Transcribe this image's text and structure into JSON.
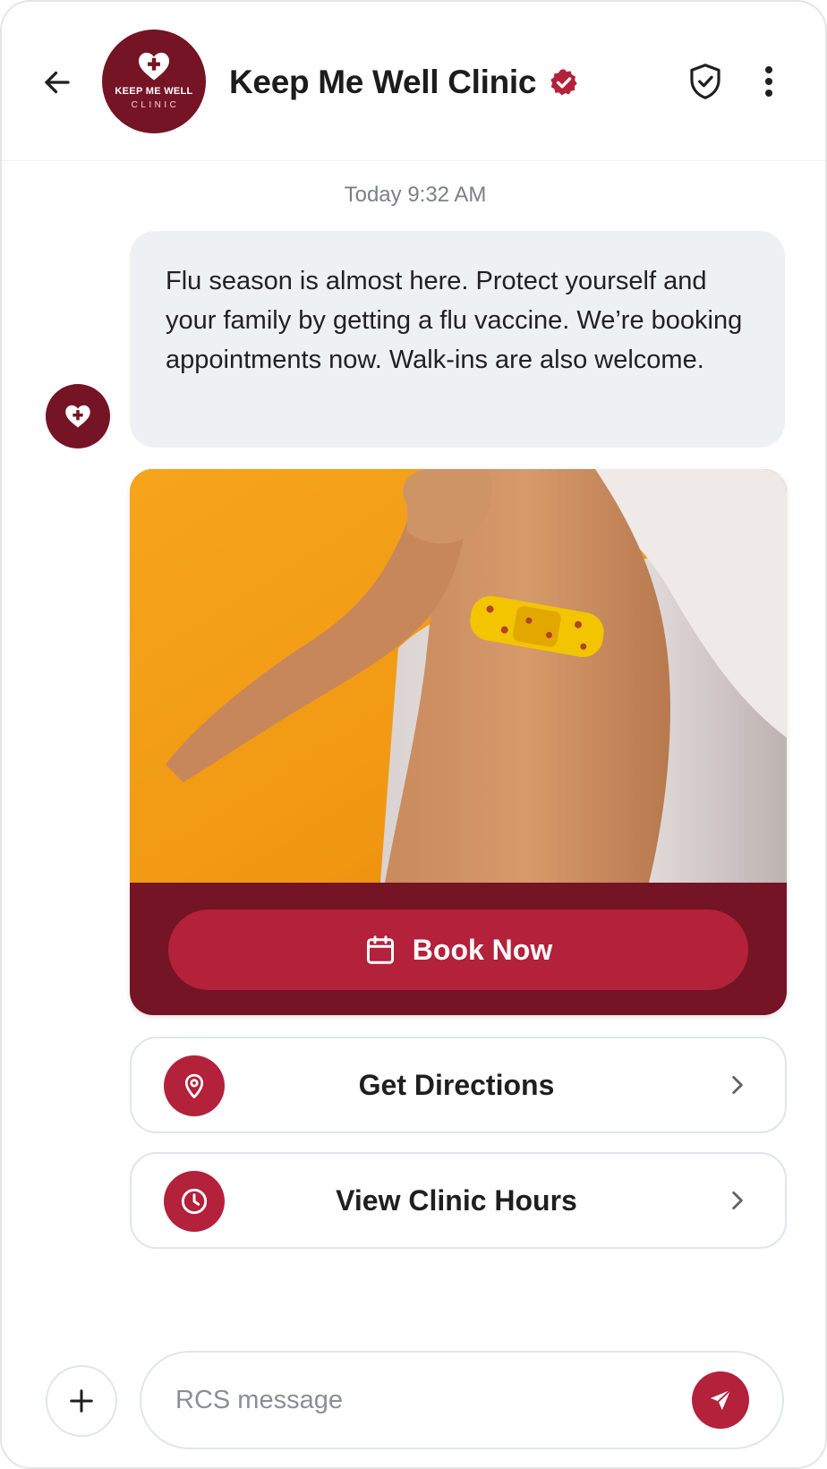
{
  "header": {
    "title": "Keep Me Well Clinic",
    "logo_line1": "KEEP ME WELL",
    "logo_line2": "CLINIC",
    "icons": {
      "back": "arrow-left-icon",
      "verified": "verified-badge-icon",
      "shield": "shield-check-icon",
      "more": "more-vertical-icon"
    }
  },
  "conversation": {
    "timestamp": "Today 9:32 AM",
    "message": "Flu season is almost here. Protect yourself and your family by getting a flu vaccine. We’re booking appointments now. Walk-ins are also welcome.",
    "avatar_icon": "heart-plus-icon"
  },
  "card": {
    "image_alt": "Person showing a bandage on their upper arm after a vaccine",
    "button_label": "Book Now",
    "button_icon": "calendar-icon"
  },
  "suggestions": [
    {
      "label": "Get Directions",
      "icon": "map-pin-icon"
    },
    {
      "label": "View Clinic Hours",
      "icon": "clock-icon"
    }
  ],
  "composer": {
    "placeholder": "RCS message",
    "value": "",
    "add_icon": "plus-icon",
    "send_icon": "send-icon"
  },
  "colors": {
    "brand_dark": "#751424",
    "brand_accent": "#b3213a",
    "bubble_bg": "#eef1f4",
    "image_orange": "#f29a10"
  }
}
